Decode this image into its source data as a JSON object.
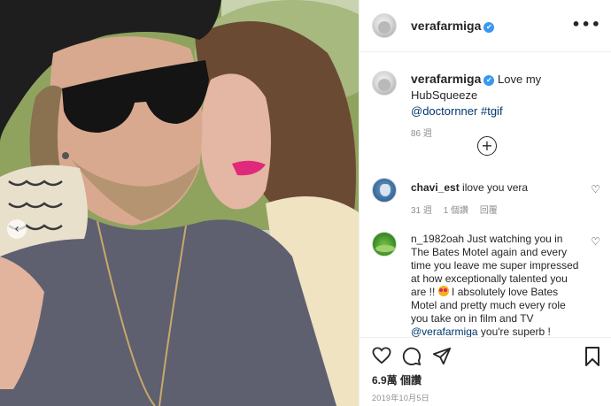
{
  "post": {
    "username": "verafarmiga",
    "verified_icon": "verified-badge-icon",
    "more_icon": "more-options-icon",
    "more_glyph": "•••",
    "caption": {
      "text": "Love my HubSqueeze",
      "mention": "@doctornner",
      "hashtag": "#tgif",
      "time": "86 週"
    },
    "load_more_glyph": "+",
    "carousel_glyph": "‹"
  },
  "comments": [
    {
      "username": "chavi_est",
      "text": "ilove you vera",
      "time": "31 週",
      "likes": "1 個讚",
      "reply": "回覆"
    },
    {
      "username": "n_1982oah",
      "text_before_emoji": "Just watching you in The Bates Motel again and every time you leave me super impressed at how exceptionally talented you are !!",
      "text_after_emoji": "I absolutely love Bates Motel and pretty much every role you take on in film and TV",
      "mention": "@verafarmiga",
      "text_end": "you're superb !",
      "emoji": "heart-eyes-emoji"
    }
  ],
  "actions": {
    "like_icon": "heart-icon",
    "comment_icon": "comment-icon",
    "share_icon": "share-icon",
    "save_icon": "bookmark-icon"
  },
  "stats": {
    "likes": "6.9萬 個讚",
    "date": "2019年10月5日"
  },
  "colors": {
    "link": "#00376b",
    "verified": "#3897f0",
    "muted": "#8e8e8e"
  }
}
